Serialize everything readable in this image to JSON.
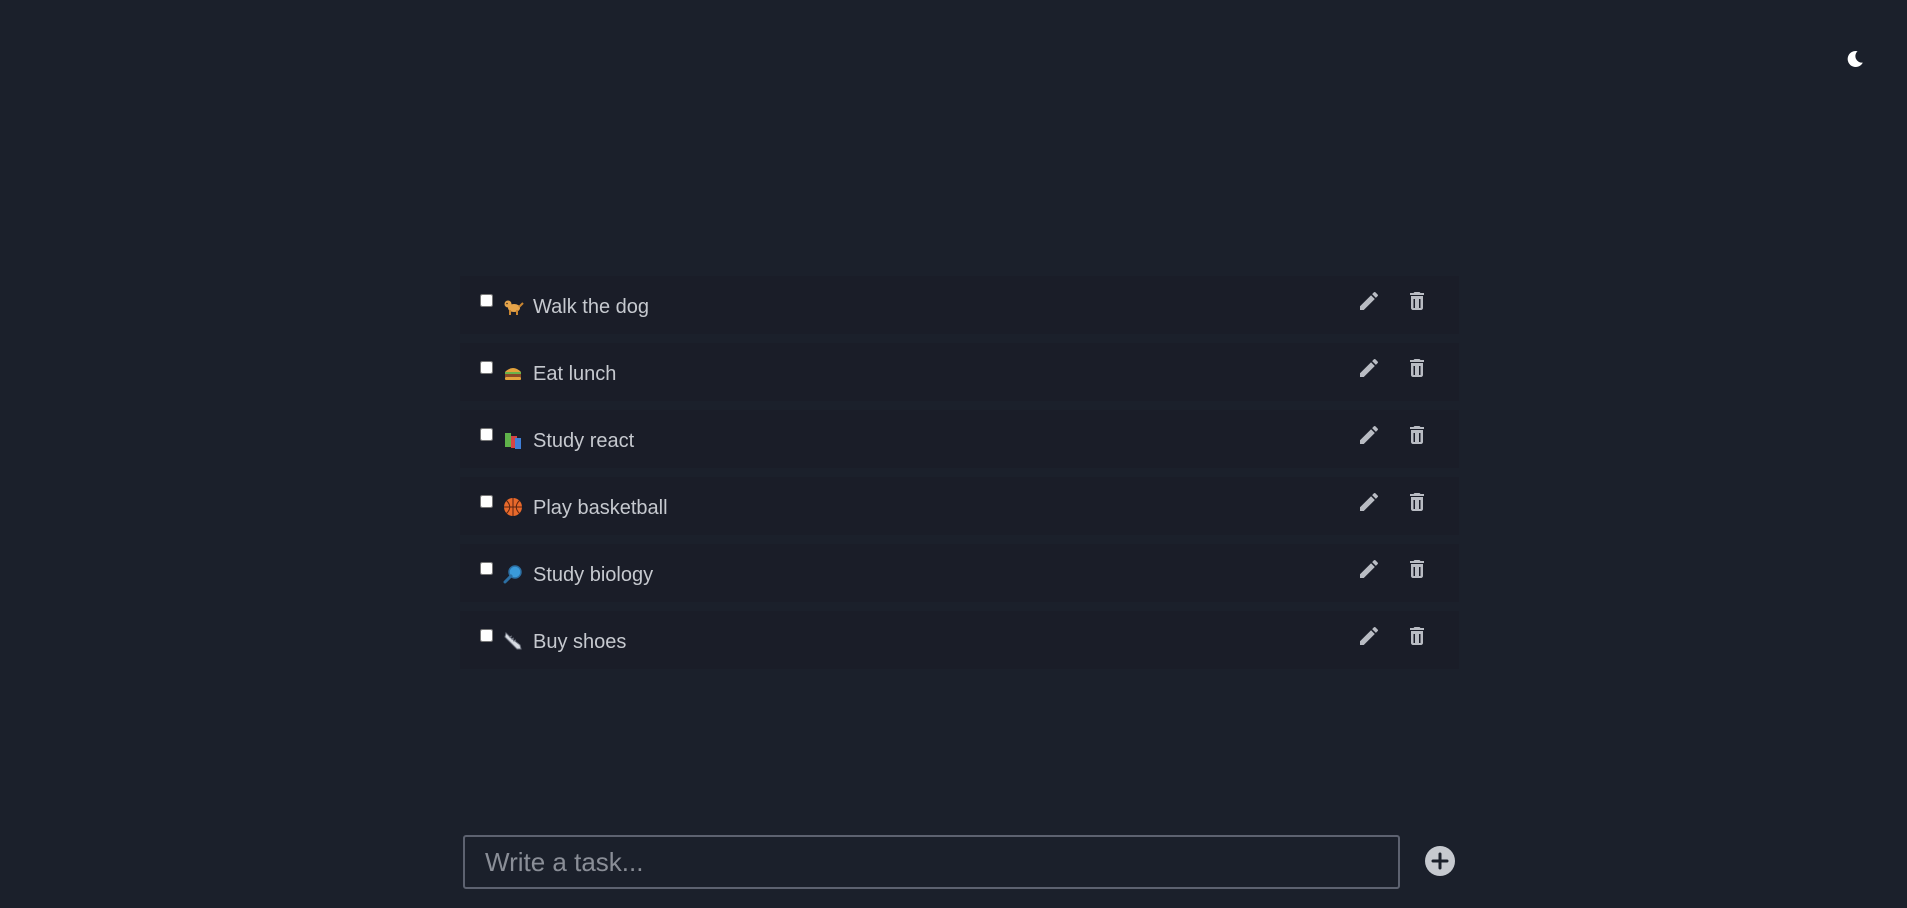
{
  "tasks": [
    {
      "emoji": "dog-emoji",
      "label": "Walk the dog",
      "done": false
    },
    {
      "emoji": "burger-emoji",
      "label": "Eat lunch",
      "done": false
    },
    {
      "emoji": "books-emoji",
      "label": "Study react",
      "done": false
    },
    {
      "emoji": "basketball-emoji",
      "label": "Play basketball",
      "done": false
    },
    {
      "emoji": "magnifier-emoji",
      "label": "Study biology",
      "done": false
    },
    {
      "emoji": "shoe-emoji",
      "label": "Buy shoes",
      "done": false
    }
  ],
  "composer": {
    "placeholder": "Write a task..."
  },
  "theme_toggle": {
    "icon": "moon-icon"
  },
  "colors": {
    "background": "#1b202b",
    "task_row": "#1a1d28",
    "text": "#c6c9cf",
    "icon": "#b9bcc3"
  }
}
